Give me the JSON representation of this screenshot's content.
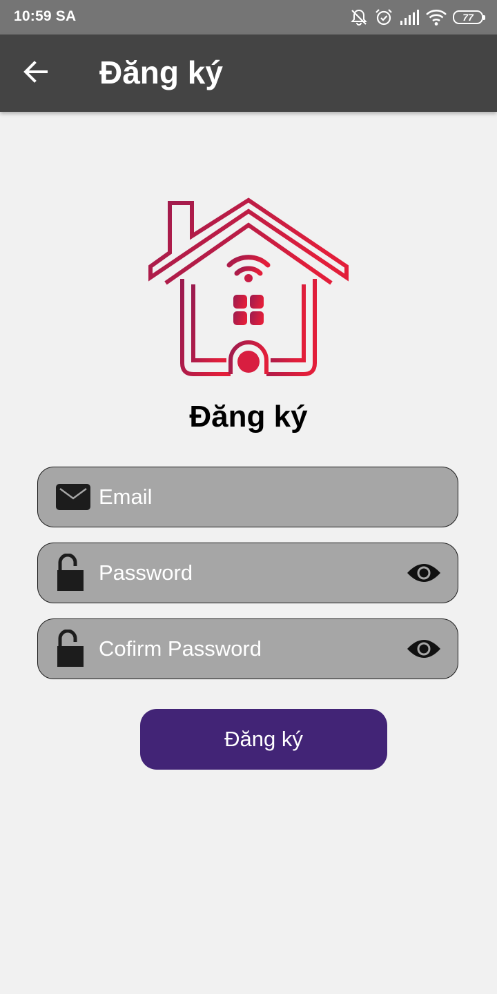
{
  "status_bar": {
    "time": "10:59 SA",
    "battery": "77",
    "icons": [
      "mute-icon",
      "alarm-icon",
      "signal-icon",
      "wifi-icon",
      "battery-icon"
    ]
  },
  "app_bar": {
    "title": "Đăng ký",
    "back_icon": "arrow-left-icon",
    "background_color": "#444444"
  },
  "logo": {
    "icon": "smart-home-icon",
    "gradient_colors": [
      "#9b1b4f",
      "#e21e3a"
    ]
  },
  "form": {
    "heading": "Đăng ký",
    "email": {
      "placeholder": "Email",
      "value": "",
      "icon": "envelope-icon"
    },
    "password": {
      "placeholder": "Password",
      "value": "",
      "icon": "unlocked-padlock-icon",
      "toggle_icon": "eye-icon"
    },
    "confirm_password": {
      "placeholder": "Cofirm Password",
      "value": "",
      "icon": "unlocked-padlock-icon",
      "toggle_icon": "eye-icon"
    },
    "submit_label": "Đăng ký",
    "field_color": "#a6a6a6",
    "button_color": "#422476"
  }
}
